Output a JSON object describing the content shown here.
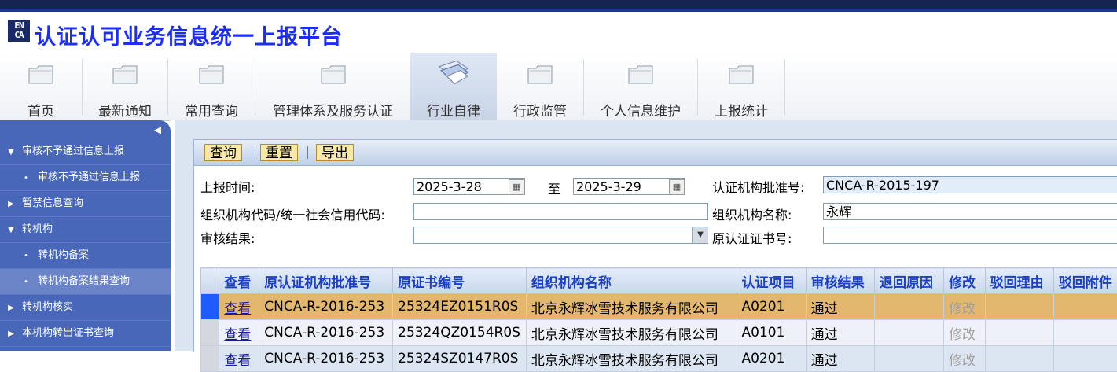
{
  "header": {
    "logo_text": "EN CA",
    "title": "认证认可业务信息统一上报平台"
  },
  "nav": [
    {
      "label": "首页"
    },
    {
      "label": "最新通知"
    },
    {
      "label": "常用查询"
    },
    {
      "label": "管理体系及服务认证"
    },
    {
      "label": "行业自律"
    },
    {
      "label": "行政监管"
    },
    {
      "label": "个人信息维护"
    },
    {
      "label": "上报统计"
    }
  ],
  "sidebar": {
    "items": [
      {
        "label": "审核不予通过信息上报",
        "expanded": true
      },
      {
        "label": "审核不予通过信息上报",
        "sub": true
      },
      {
        "label": "暂禁信息查询"
      },
      {
        "label": "转机构",
        "expanded": true
      },
      {
        "label": "转机构备案",
        "sub": true
      },
      {
        "label": "转机构备案结果查询",
        "sub": true,
        "selected": true
      },
      {
        "label": "转机构核实"
      },
      {
        "label": "本机构转出证书查询"
      }
    ]
  },
  "toolbar": {
    "query": "查询",
    "reset": "重置",
    "export": "导出"
  },
  "form": {
    "report_time_label": "上报时间:",
    "date_from": "2025-3-28",
    "to_label": "至",
    "date_to": "2025-3-29",
    "org_approval_label": "认证机构批准号:",
    "org_approval_value": "CNCA-R-2015-197",
    "org_code_label": "组织机构代码/统一社会信用代码:",
    "org_code_value": "",
    "org_name_label": "组织机构名称:",
    "org_name_value": "永辉",
    "audit_result_label": "审核结果:",
    "audit_result_value": "",
    "orig_cert_label": "原认证证书号:",
    "orig_cert_value": ""
  },
  "table": {
    "columns": [
      "查看",
      "原认证机构批准号",
      "原证书编号",
      "组织机构名称",
      "认证项目",
      "审核结果",
      "退回原因",
      "修改",
      "驳回理由",
      "驳回附件"
    ],
    "rows": [
      {
        "view": "查看",
        "orig_approval": "CNCA-R-2016-253",
        "cert_no": "25324EZ0151R0S",
        "org_name": "北京永辉冰雪技术服务有限公司",
        "item": "A0201",
        "result": "通过",
        "return_reason": "",
        "modify": "修改",
        "reject_reason": "",
        "reject_attach": ""
      },
      {
        "view": "查看",
        "orig_approval": "CNCA-R-2016-253",
        "cert_no": "25324QZ0154R0S",
        "org_name": "北京永辉冰雪技术服务有限公司",
        "item": "A0101",
        "result": "通过",
        "return_reason": "",
        "modify": "修改",
        "reject_reason": "",
        "reject_attach": ""
      },
      {
        "view": "查看",
        "orig_approval": "CNCA-R-2016-253",
        "cert_no": "25324SZ0147R0S",
        "org_name": "北京永辉冰雪技术服务有限公司",
        "item": "A0201",
        "result": "通过",
        "return_reason": "",
        "modify": "修改",
        "reject_reason": "",
        "reject_attach": ""
      }
    ]
  },
  "colors": {
    "title": "#1a2cff",
    "sidebar": "#4867b8",
    "selected_row": "#e3b86e",
    "header_text": "#1a40c8"
  }
}
